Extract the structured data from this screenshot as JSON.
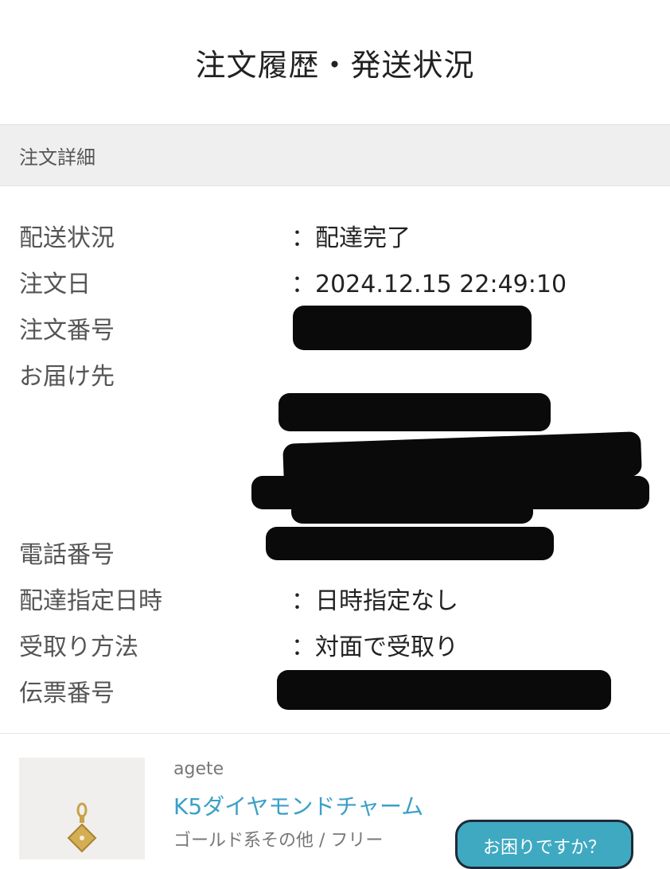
{
  "header": {
    "title": "注文履歴・発送状況"
  },
  "section": {
    "title": "注文詳細"
  },
  "details": {
    "shipping_status_label": "配送状況",
    "shipping_status_value": "：配達完了",
    "order_date_label": "注文日",
    "order_date_value": "：2024.12.15 22:49:10",
    "order_number_label": "注文番号",
    "destination_label": "お届け先",
    "phone_label": "電話番号",
    "delivery_datetime_label": "配達指定日時",
    "delivery_datetime_value": "：日時指定なし",
    "receipt_method_label": "受取り方法",
    "receipt_method_value": "：対面で受取り",
    "slip_number_label": "伝票番号"
  },
  "product": {
    "brand": "agete",
    "name": "K5ダイヤモンドチャーム",
    "variant": "ゴールド系その他 / フリー"
  },
  "help_button": {
    "label": "お困りですか？"
  },
  "colors": {
    "link": "#3aa0c8",
    "help_button": "#3fa9c2",
    "redaction": "#0a0a0a"
  }
}
